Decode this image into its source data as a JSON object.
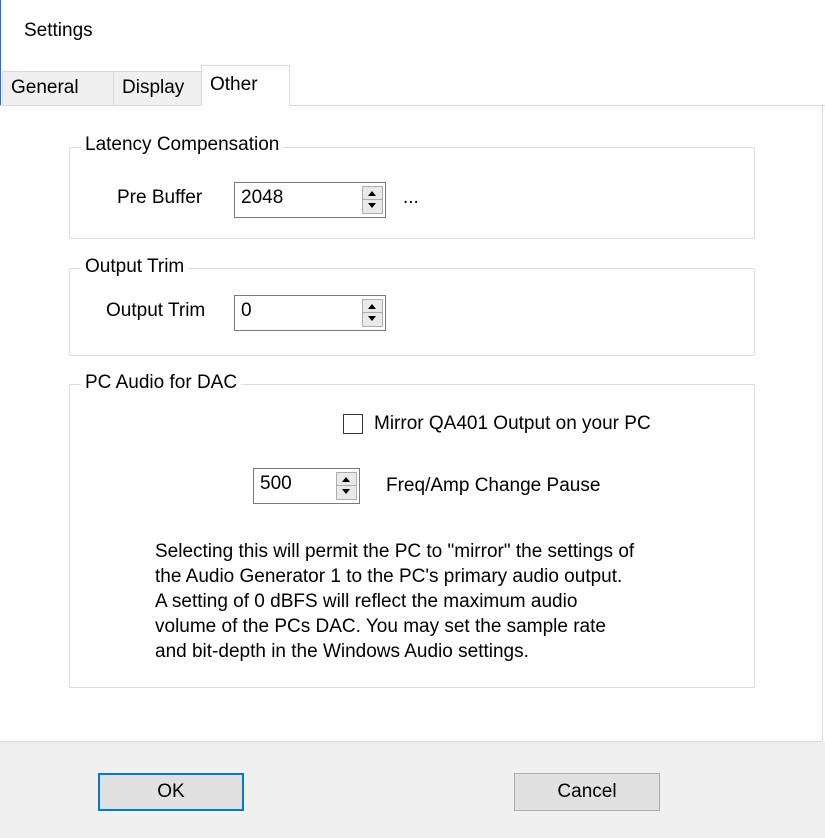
{
  "window": {
    "title": "Settings"
  },
  "tabs": [
    {
      "label": "General",
      "active": false
    },
    {
      "label": "Display",
      "active": false
    },
    {
      "label": "Other",
      "active": true
    }
  ],
  "latency": {
    "group_title": "Latency Compensation",
    "pre_buffer_label": "Pre Buffer",
    "pre_buffer_value": "2048",
    "ellipsis_label": "..."
  },
  "output_trim": {
    "group_title": "Output Trim",
    "label": "Output Trim",
    "value": "0"
  },
  "pc_audio": {
    "group_title": "PC Audio for DAC",
    "mirror_label": "Mirror QA401 Output on your PC",
    "mirror_checked": false,
    "pause_value": "500",
    "pause_label": "Freq/Amp Change Pause",
    "description": "Selecting this will permit the PC to \"mirror\" the settings of\nthe Audio Generator 1 to the PC's primary audio output.\nA setting of 0 dBFS will reflect the maximum audio\nvolume of the PCs DAC. You may set the sample rate\nand bit-depth in the Windows Audio settings."
  },
  "buttons": {
    "ok": "OK",
    "cancel": "Cancel"
  },
  "colors": {
    "accent": "#0078d7",
    "footer_bg": "#f0f0f0"
  }
}
